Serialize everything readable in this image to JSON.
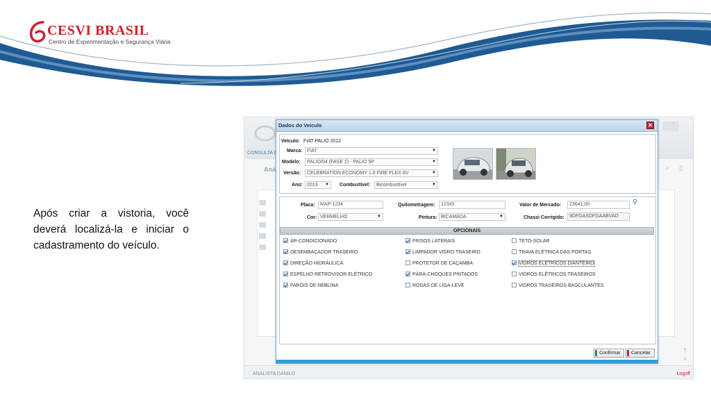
{
  "slide": {
    "logo": {
      "brand": "CESVI BRASIL",
      "subtitle": "Centro de Experimentação e Segurança Viária",
      "color": "#c8232c"
    },
    "caption": "Após criar a vistoria, você deverá localizá-la e iniciar o cadastramento do veículo."
  },
  "app": {
    "consulta_label": "CONSULTA DE",
    "ana_label": "Anál",
    "user_label": "ANALISTA DANILO",
    "logoff_label": "Logoff"
  },
  "dialog": {
    "title": "Dados do Veículo",
    "close_icon": "close-icon",
    "vehicle": {
      "veiculo_label": "Veículo:",
      "veiculo_value": "FIAT PALIO 2012",
      "marca_label": "Marca:",
      "marca_value": "FIAT",
      "modelo_label": "Modelo:",
      "modelo_value": "PALIO/04 (FASE 2) - PALIO 5P",
      "versao_label": "Versão:",
      "versao_value": "CELEBRATION ECONOMY 1.0 FIRE FLEX 8V",
      "ano_label": "Ano:",
      "ano_value": "2013",
      "combustivel_label": "Combustível:",
      "combustivel_value": "Bicombustível"
    },
    "details": {
      "placa_label": "Placa:",
      "placa_value": "MAP-1234",
      "quilometragem_label": "Quilometragem:",
      "quilometragem_value": "12345",
      "valor_label": "Valor de Mercado:",
      "valor_value": "23641,00",
      "cor_label": "Cor:",
      "cor_value": "VERMELHO",
      "pintura_label": "Pintura:",
      "pintura_value": "BICAMADA",
      "chassi_label": "Chassi Corrigido:",
      "chassi_value": "9DFGASDFGAABVAD"
    },
    "opcionais_title": "OPCIONAIS",
    "opcionais": [
      {
        "label": "AR-CONDICIONADO",
        "checked": true
      },
      {
        "label": "FRISOS LATERAIS",
        "checked": true
      },
      {
        "label": "TETO-SOLAR",
        "checked": false
      },
      {
        "label": "DESEMBAÇADOR TRASEIRO",
        "checked": true
      },
      {
        "label": "LIMPADOR VIDRO TRASEIRO",
        "checked": true
      },
      {
        "label": "TRAVA ELÉTRICA DAS PORTAS",
        "checked": false
      },
      {
        "label": "DIREÇÃO HIDRÁULICA",
        "checked": true
      },
      {
        "label": "PROTETOR DE CAÇAMBA",
        "checked": false
      },
      {
        "label": "VIDROS ELÉTRICOS DIANTEIRO",
        "checked": true
      },
      {
        "label": "ESPELHO RETROVISOR ELÉTRICO",
        "checked": true
      },
      {
        "label": "PÁRA-CHOQUES PINTADOS",
        "checked": true
      },
      {
        "label": "VIDROS ELÉTRICOS TRASEIROS",
        "checked": false
      },
      {
        "label": "FARÓIS DE NEBLINA",
        "checked": true
      },
      {
        "label": "RODAS DE LIGA-LEVE",
        "checked": false
      },
      {
        "label": "VIDROS TRASEIROS BASCULANTES",
        "checked": false
      }
    ],
    "buttons": {
      "confirm_label": "Confirmar",
      "confirm_color": "#2f8f3a",
      "cancel_label": "Cancelar",
      "cancel_color": "#c0282d"
    },
    "accent_color": "#2b9fd8"
  }
}
